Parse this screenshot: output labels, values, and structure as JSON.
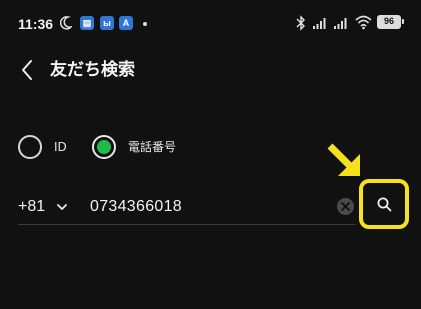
{
  "status_bar": {
    "time": "11:36",
    "app_icons": [
      "▤",
      "ы",
      "A"
    ],
    "battery": "96"
  },
  "header": {
    "title": "友だち検索"
  },
  "search_type": {
    "options": [
      {
        "label": "ID",
        "selected": false
      },
      {
        "label": "電話番号",
        "selected": true
      }
    ]
  },
  "phone": {
    "country_code": "+81",
    "number": "0734366018"
  },
  "colors": {
    "background": "#111111",
    "selected_radio": "#21b94a",
    "highlight": "#f5e11c"
  },
  "icons": [
    "moon-icon",
    "bluetooth-icon",
    "signal-icon",
    "wifi-icon",
    "battery-icon",
    "back-icon",
    "chevron-down-icon",
    "clear-icon",
    "search-icon",
    "arrow-annotation-icon"
  ]
}
